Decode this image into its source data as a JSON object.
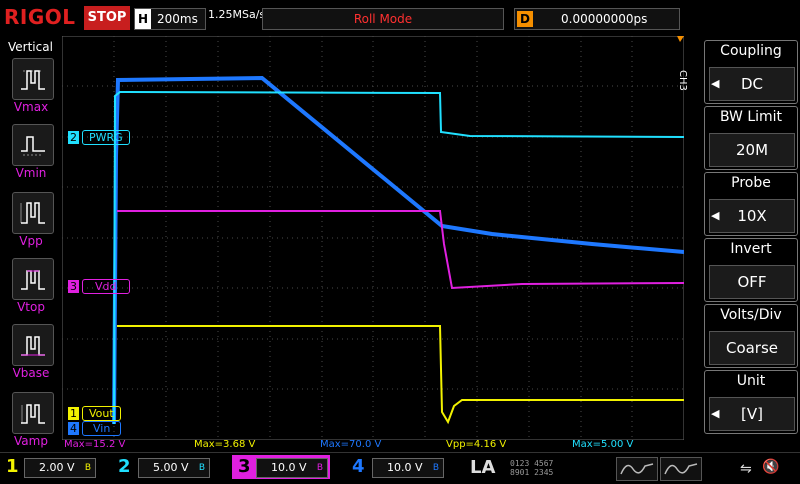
{
  "header": {
    "brand": "RIGOL",
    "run_state": "STOP",
    "timebase_key": "H",
    "timebase_value": "200ms",
    "sample_rate": "1.25MSa/s",
    "trigger_mode": "Roll Mode",
    "delay_key": "D",
    "delay_value": "0.00000000ps"
  },
  "measure_panel": {
    "title": "Vertical",
    "items": [
      {
        "label": "Vmax",
        "icon": "vmax-icon"
      },
      {
        "label": "Vmin",
        "icon": "vmin-icon"
      },
      {
        "label": "Vpp",
        "icon": "vpp-icon"
      },
      {
        "label": "Vtop",
        "icon": "vtop-icon"
      },
      {
        "label": "Vbase",
        "icon": "vbase-icon"
      },
      {
        "label": "Vamp",
        "icon": "vamp-icon"
      }
    ]
  },
  "channel_labels": {
    "ch1": {
      "num": "1",
      "name": "Vout"
    },
    "ch2": {
      "num": "2",
      "name": "PWRG"
    },
    "ch3": {
      "num": "3",
      "name": "Vdd"
    },
    "ch4": {
      "num": "4",
      "name": "Vin"
    }
  },
  "right_menu": {
    "channel_tag": "CH3",
    "items": [
      {
        "title": "Coupling",
        "value": "DC"
      },
      {
        "title": "BW Limit",
        "value": "20M"
      },
      {
        "title": "Probe",
        "value": "10X"
      },
      {
        "title": "Invert",
        "value": "OFF"
      },
      {
        "title": "Volts/Div",
        "value": "Coarse"
      },
      {
        "title": "Unit",
        "value": "[V]"
      }
    ]
  },
  "measurements": [
    {
      "text": "Max=15.2 V",
      "color": "#e020e0"
    },
    {
      "text": "Max=3.68 V",
      "color": "#f2f200"
    },
    {
      "text": "Max=70.0 V",
      "color": "#1e78ff"
    },
    {
      "text": "Vpp=4.16 V",
      "color": "#f2f200"
    },
    {
      "text": "Max=5.00 V",
      "color": "#20e0ff"
    }
  ],
  "channels": [
    {
      "num": "1",
      "scale": "2.00 V",
      "color": "#f2f200"
    },
    {
      "num": "2",
      "scale": "5.00 V",
      "color": "#20e0ff"
    },
    {
      "num": "3",
      "scale": "10.0 V",
      "color": "#e020e0"
    },
    {
      "num": "4",
      "scale": "10.0 V",
      "color": "#1e78ff"
    }
  ],
  "footer": {
    "la_label": "LA",
    "la_bits_row1": "0123 4567",
    "la_bits_row2": "8901 2345"
  },
  "colors": {
    "ch1": "#f2f200",
    "ch2": "#20e0ff",
    "ch3": "#e020e0",
    "ch4": "#1e78ff",
    "trigger": "#f58f00",
    "stop": "#c81e1e"
  }
}
